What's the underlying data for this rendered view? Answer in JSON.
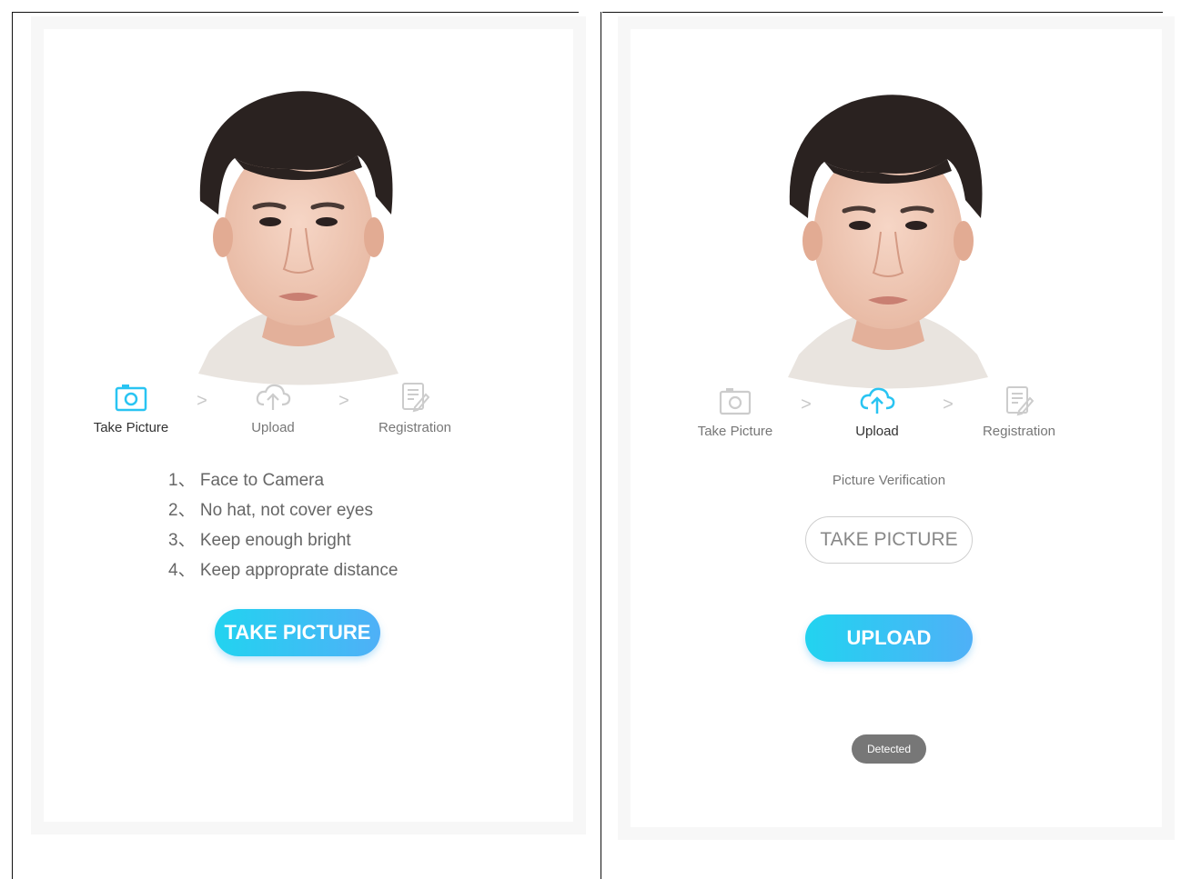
{
  "left_screen": {
    "steps": [
      {
        "label": "Take Picture",
        "icon": "camera-icon",
        "active": true
      },
      {
        "label": "Upload",
        "icon": "cloud-upload-icon",
        "active": false
      },
      {
        "label": "Registration",
        "icon": "form-edit-icon",
        "active": false
      }
    ],
    "instructions": [
      "1、 Face to Camera",
      "2、 No hat, not cover eyes",
      "3、 Keep enough bright",
      "4、 Keep approprate distance"
    ],
    "take_picture_label": "TAKE PICTURE"
  },
  "right_screen": {
    "steps": [
      {
        "label": "Take Picture",
        "icon": "camera-icon",
        "active": false
      },
      {
        "label": "Upload",
        "icon": "cloud-upload-icon",
        "active": true
      },
      {
        "label": "Registration",
        "icon": "form-edit-icon",
        "active": false
      }
    ],
    "verification_text": "Picture Verification",
    "take_picture_label": "TAKE PICTURE",
    "upload_label": "UPLOAD",
    "toast": "Detected"
  },
  "colors": {
    "accent": "#29c4f2",
    "gradient_start": "#22d3f0",
    "gradient_end": "#4fb0f7",
    "inactive_icon": "#cccccc"
  }
}
